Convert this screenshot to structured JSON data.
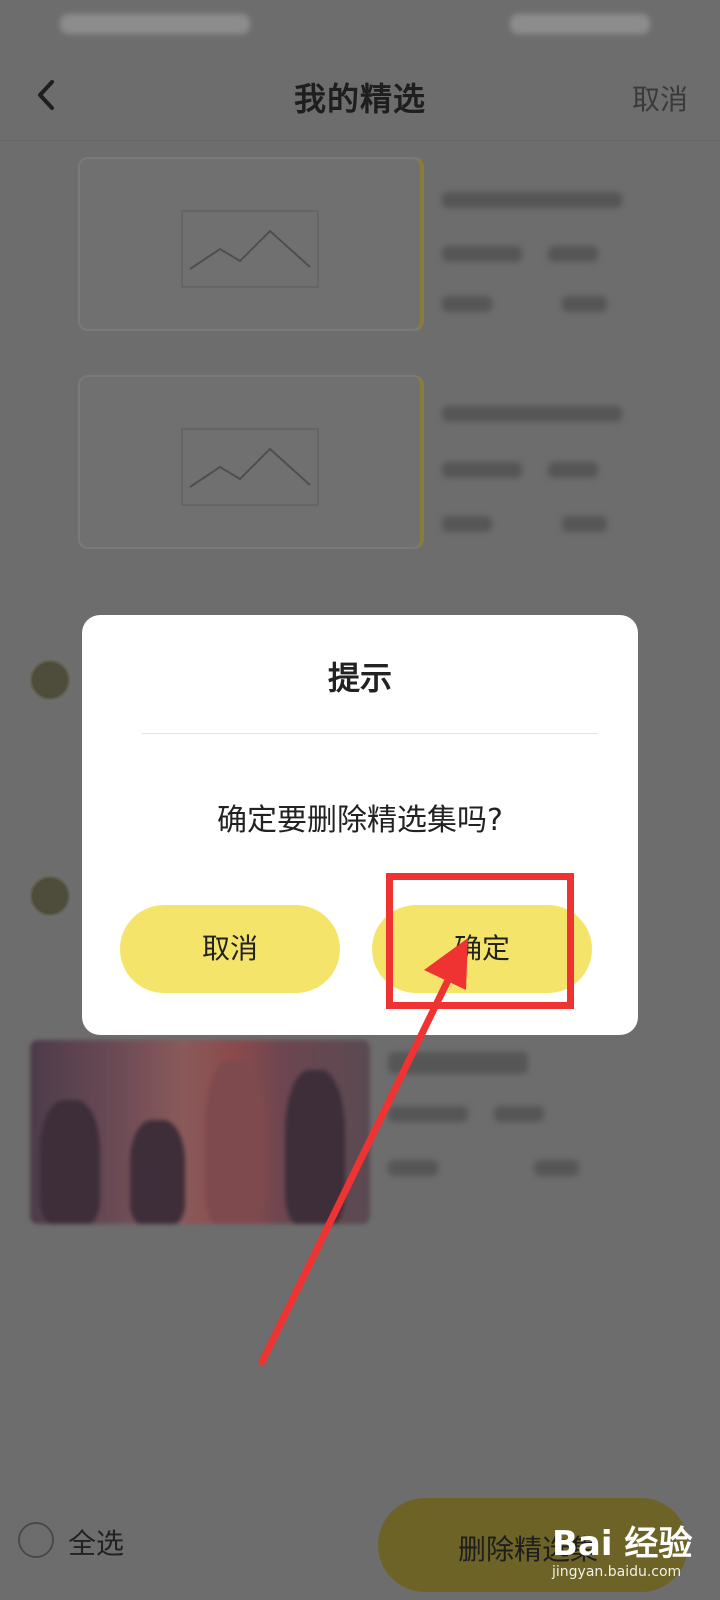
{
  "nav": {
    "title": "我的精选",
    "cancel_label": "取消"
  },
  "bottom_bar": {
    "select_all_label": "全选",
    "delete_label": "删除精选集"
  },
  "dialog": {
    "title": "提示",
    "message": "确定要删除精选集吗?",
    "cancel_label": "取消",
    "confirm_label": "确定"
  },
  "annotation_color": "#ef3333",
  "watermark": {
    "logo": "Bai 经验",
    "sub": "jingyan.baidu.com"
  }
}
